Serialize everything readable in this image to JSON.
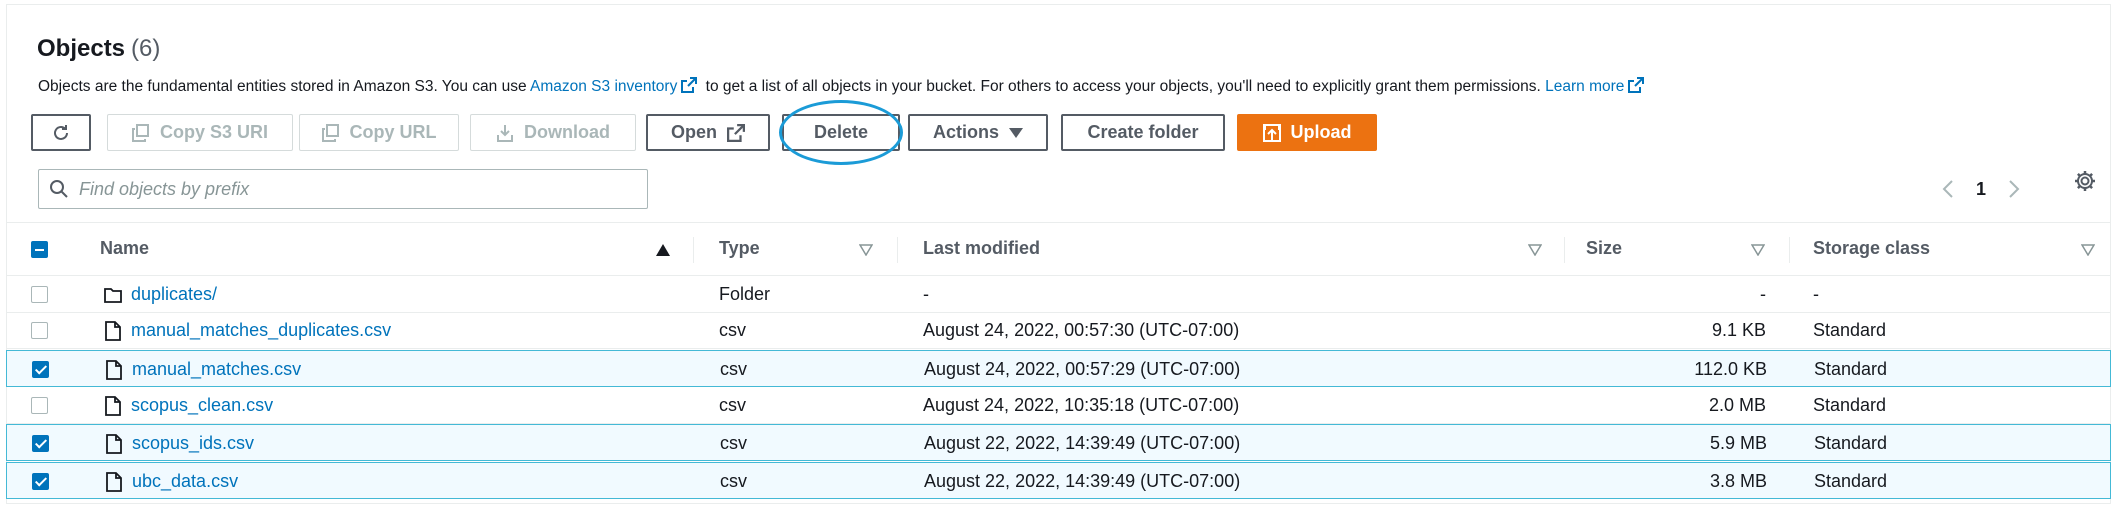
{
  "header": {
    "title": "Objects",
    "count": "(6)",
    "description": {
      "part1": "Objects are the fundamental entities stored in Amazon S3. You can use ",
      "link1": "Amazon S3 inventory",
      "part2": " to get a list of all objects in your bucket. For others to access your objects, you'll need to explicitly grant them permissions. ",
      "link2": "Learn more"
    }
  },
  "toolbar": {
    "copy_uri": "Copy S3 URI",
    "copy_url": "Copy URL",
    "download": "Download",
    "open": "Open",
    "delete": "Delete",
    "actions": "Actions",
    "create_folder": "Create folder",
    "upload": "Upload"
  },
  "search": {
    "placeholder": "Find objects by prefix"
  },
  "pagination": {
    "page": "1"
  },
  "table": {
    "columns": [
      "Name",
      "Type",
      "Last modified",
      "Size",
      "Storage class"
    ],
    "rows": [
      {
        "name": "duplicates/",
        "type": "Folder",
        "modified": "-",
        "size": "-",
        "storage": "-",
        "kind": "folder",
        "selected": false
      },
      {
        "name": "manual_matches_duplicates.csv",
        "type": "csv",
        "modified": "August 24, 2022, 00:57:30 (UTC-07:00)",
        "size": "9.1 KB",
        "storage": "Standard",
        "kind": "file",
        "selected": false
      },
      {
        "name": "manual_matches.csv",
        "type": "csv",
        "modified": "August 24, 2022, 00:57:29 (UTC-07:00)",
        "size": "112.0 KB",
        "storage": "Standard",
        "kind": "file",
        "selected": true
      },
      {
        "name": "scopus_clean.csv",
        "type": "csv",
        "modified": "August 24, 2022, 10:35:18 (UTC-07:00)",
        "size": "2.0 MB",
        "storage": "Standard",
        "kind": "file",
        "selected": false
      },
      {
        "name": "scopus_ids.csv",
        "type": "csv",
        "modified": "August 22, 2022, 14:39:49 (UTC-07:00)",
        "size": "5.9 MB",
        "storage": "Standard",
        "kind": "file",
        "selected": true
      },
      {
        "name": "ubc_data.csv",
        "type": "csv",
        "modified": "August 22, 2022, 14:39:49 (UTC-07:00)",
        "size": "3.8 MB",
        "storage": "Standard",
        "kind": "file",
        "selected": true
      }
    ]
  },
  "colors": {
    "link": "#0073bb",
    "primary": "#ec7211",
    "highlight": "#1b9bd7",
    "selected_bg": "#f1faff"
  }
}
